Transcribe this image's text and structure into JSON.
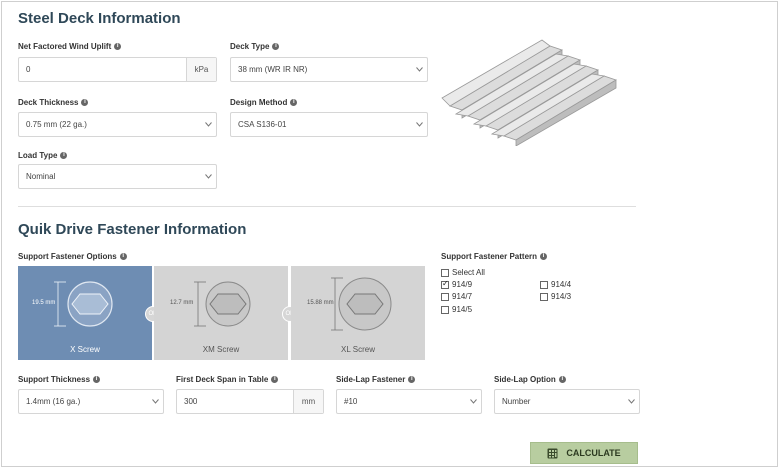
{
  "steel_deck": {
    "title": "Steel Deck Information",
    "wind_uplift": {
      "label": "Net Factored Wind Uplift",
      "value": "0",
      "unit": "kPa"
    },
    "deck_type": {
      "label": "Deck Type",
      "value": "38 mm (WR IR NR)"
    },
    "deck_thickness": {
      "label": "Deck Thickness",
      "value": "0.75 mm (22 ga.)"
    },
    "design_method": {
      "label": "Design Method",
      "value": "CSA S136-01"
    },
    "load_type": {
      "label": "Load Type",
      "value": "Nominal"
    }
  },
  "fastener": {
    "title": "Quik Drive Fastener Information",
    "support_options_label": "Support Fastener Options",
    "screws": [
      {
        "name": "X Screw",
        "dim": "19.5 mm"
      },
      {
        "name": "XM Screw",
        "dim": "12.7 mm"
      },
      {
        "name": "XL Screw",
        "dim": "15.88 mm"
      }
    ],
    "or_label": "OR",
    "pattern": {
      "label": "Support Fastener Pattern",
      "select_all": "Select All",
      "options": [
        "914/9",
        "914/4",
        "914/7",
        "914/3",
        "914/5"
      ]
    },
    "support_thickness": {
      "label": "Support Thickness",
      "value": "1.4mm (16 ga.)"
    },
    "first_span": {
      "label": "First Deck Span in Table",
      "value": "300",
      "unit": "mm"
    },
    "sidelap_fastener": {
      "label": "Side-Lap Fastener",
      "value": "#10"
    },
    "sidelap_option": {
      "label": "Side-Lap Option",
      "value": "Number"
    }
  },
  "calculate_label": "CALCULATE",
  "colors": {
    "selected_card": "#6e8db3",
    "card": "#d4d4d4",
    "button": "#b8cda0",
    "title": "#2f4858"
  }
}
